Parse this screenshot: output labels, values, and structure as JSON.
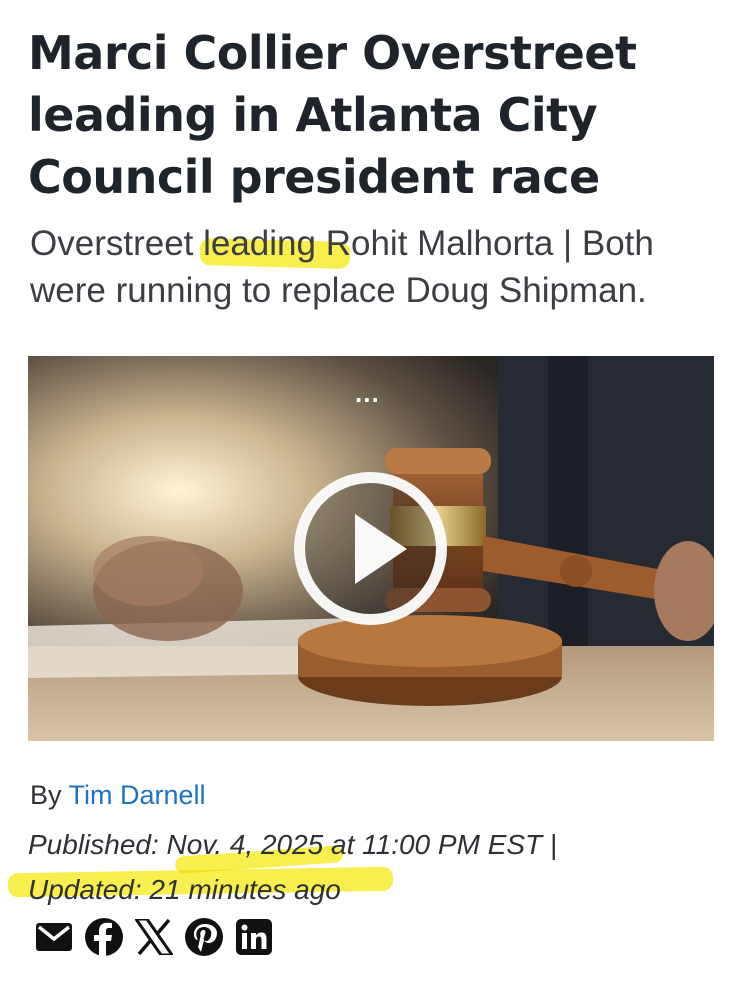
{
  "article": {
    "headline": "Marci Collier Overstreet leading in Atlanta City Council president race",
    "subhead": "Overstreet leading Rohit Malhorta | Both were running to replace Doug Shipman."
  },
  "video": {
    "more_label": "...",
    "play_icon": "play-icon"
  },
  "byline": {
    "prefix": "By",
    "author": "Tim Darnell"
  },
  "dates": {
    "published": "Published: Nov. 4, 2025 at 11:00 PM EST",
    "separator": "|",
    "updated": "Updated: 21 minutes ago"
  },
  "share": {
    "icons": [
      "email-icon",
      "facebook-icon",
      "x-icon",
      "pinterest-icon",
      "linkedin-icon"
    ]
  },
  "colors": {
    "highlight": "#f7ee3a",
    "author_link": "#1f72c4",
    "text": "#1f242b"
  }
}
